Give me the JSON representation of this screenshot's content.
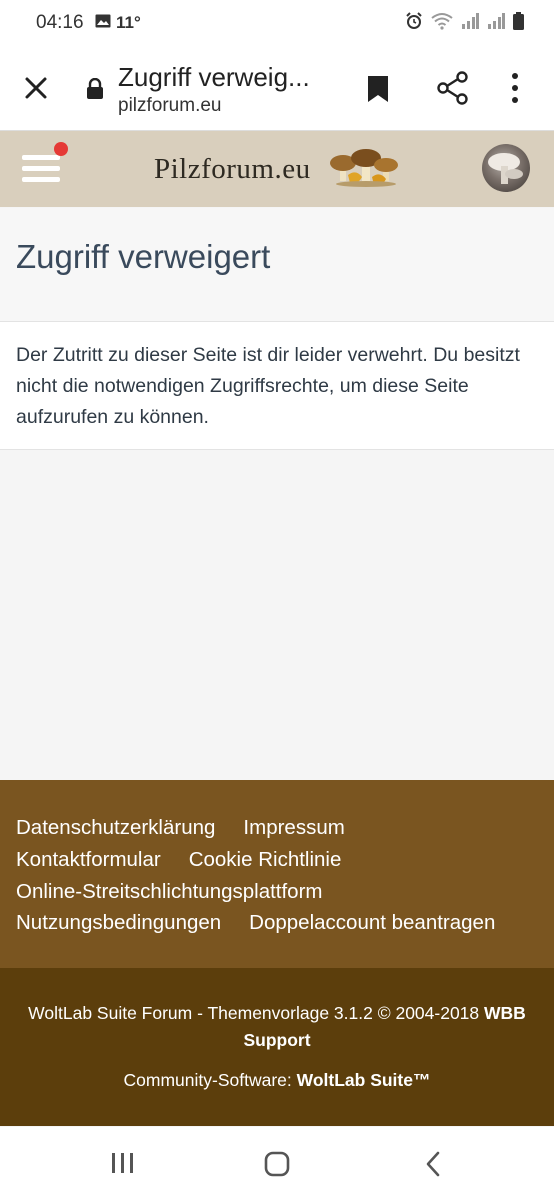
{
  "status_bar": {
    "time": "04:16",
    "temperature": "11°",
    "icons": [
      "image-icon",
      "alarm-icon",
      "wifi-icon",
      "signal-icon",
      "signal-icon",
      "battery-icon"
    ]
  },
  "browser": {
    "page_title": "Zugriff verweig...",
    "url": "pilzforum.eu",
    "icons": [
      "close-icon",
      "lock-icon",
      "bookmark-icon",
      "share-icon",
      "more-vert-icon"
    ]
  },
  "site_header": {
    "logo_text": "Pilzforum.eu",
    "has_notification": true,
    "colors": {
      "background": "#d9cfbd",
      "notification": "#e53935"
    }
  },
  "main": {
    "heading": "Zugriff verweigert",
    "message": "Der Zutritt zu dieser Seite ist dir leider verwehrt. Du besitzt nicht die notwendigen Zugriffsrechte, um diese Seite aufzurufen zu können."
  },
  "footer": {
    "links": {
      "privacy": "Datenschutzerklärung",
      "imprint": "Impressum",
      "contact": "Kontaktformular",
      "cookies": "Cookie Richtlinie",
      "odr": "Online-Streitschlichtungsplattform",
      "terms": "Nutzungsbedingungen",
      "double_account": "Doppelaccount beantragen"
    },
    "copyright_prefix": "WoltLab Suite Forum - Themenvorlage 3.1.2 © 2004-2018",
    "copyright_link": "WBB Support",
    "software_prefix": "Community-Software:",
    "software_link": "WoltLab Suite™",
    "colors": {
      "nav_bg": "#7a5520",
      "copy_bg": "#5c3e0c"
    }
  },
  "android_nav": {
    "icons": [
      "recent-apps-icon",
      "home-icon",
      "back-icon"
    ]
  }
}
